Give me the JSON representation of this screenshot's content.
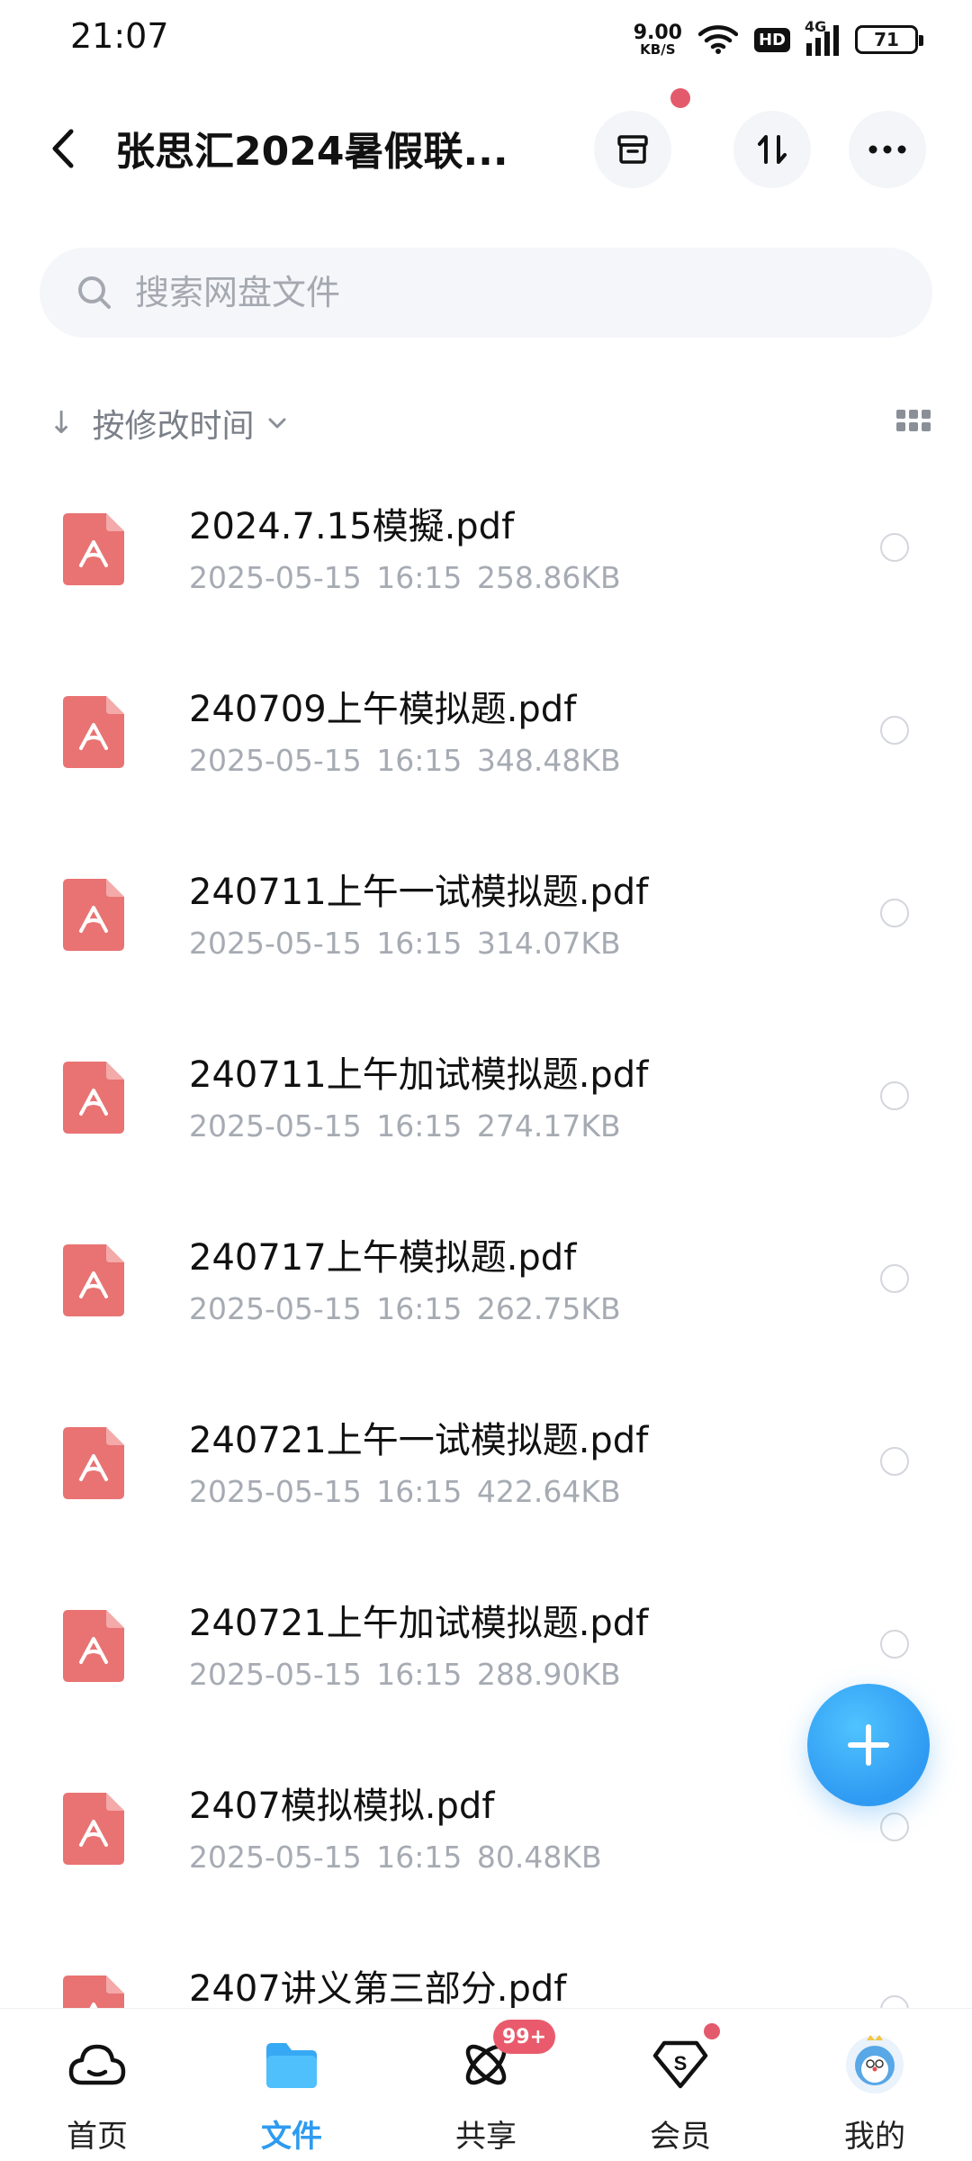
{
  "status_bar": {
    "time": "21:07",
    "net_speed_value": "9.00",
    "net_speed_unit": "KB/S",
    "hd": "HD",
    "network": "4G",
    "battery": "71"
  },
  "header": {
    "back_icon": "chevron-left-icon",
    "title": "张思汇2024暑假联...",
    "archive_icon": "archive-icon",
    "transfer_icon": "transfer-icon",
    "more_icon": "more-horizontal-icon"
  },
  "search": {
    "placeholder": "搜索网盘文件"
  },
  "sort": {
    "label": "按修改时间"
  },
  "files": [
    {
      "name": "2024.7.15模擬.pdf",
      "meta": "2025-05-15  16:15  258.86KB"
    },
    {
      "name": "240709上午模拟题.pdf",
      "meta": "2025-05-15  16:15  348.48KB"
    },
    {
      "name": "240711上午一试模拟题.pdf",
      "meta": "2025-05-15  16:15  314.07KB"
    },
    {
      "name": "240711上午加试模拟题.pdf",
      "meta": "2025-05-15  16:15  274.17KB"
    },
    {
      "name": "240717上午模拟题.pdf",
      "meta": "2025-05-15  16:15  262.75KB"
    },
    {
      "name": "240721上午一试模拟题.pdf",
      "meta": "2025-05-15  16:15  422.64KB"
    },
    {
      "name": "240721上午加试模拟题.pdf",
      "meta": "2025-05-15  16:15  288.90KB"
    },
    {
      "name": "2407模拟模拟.pdf",
      "meta": "2025-05-15  16:15  80.48KB"
    },
    {
      "name": "2407讲义第三部分.pdf",
      "meta": ""
    }
  ],
  "nav": {
    "home": "首页",
    "files": "文件",
    "share": "共享",
    "share_badge": "99+",
    "vip": "会员",
    "me": "我的"
  },
  "colors": {
    "accent": "#2e9bf0",
    "pdf": "#e86f6f",
    "badge": "#e95b6c"
  }
}
